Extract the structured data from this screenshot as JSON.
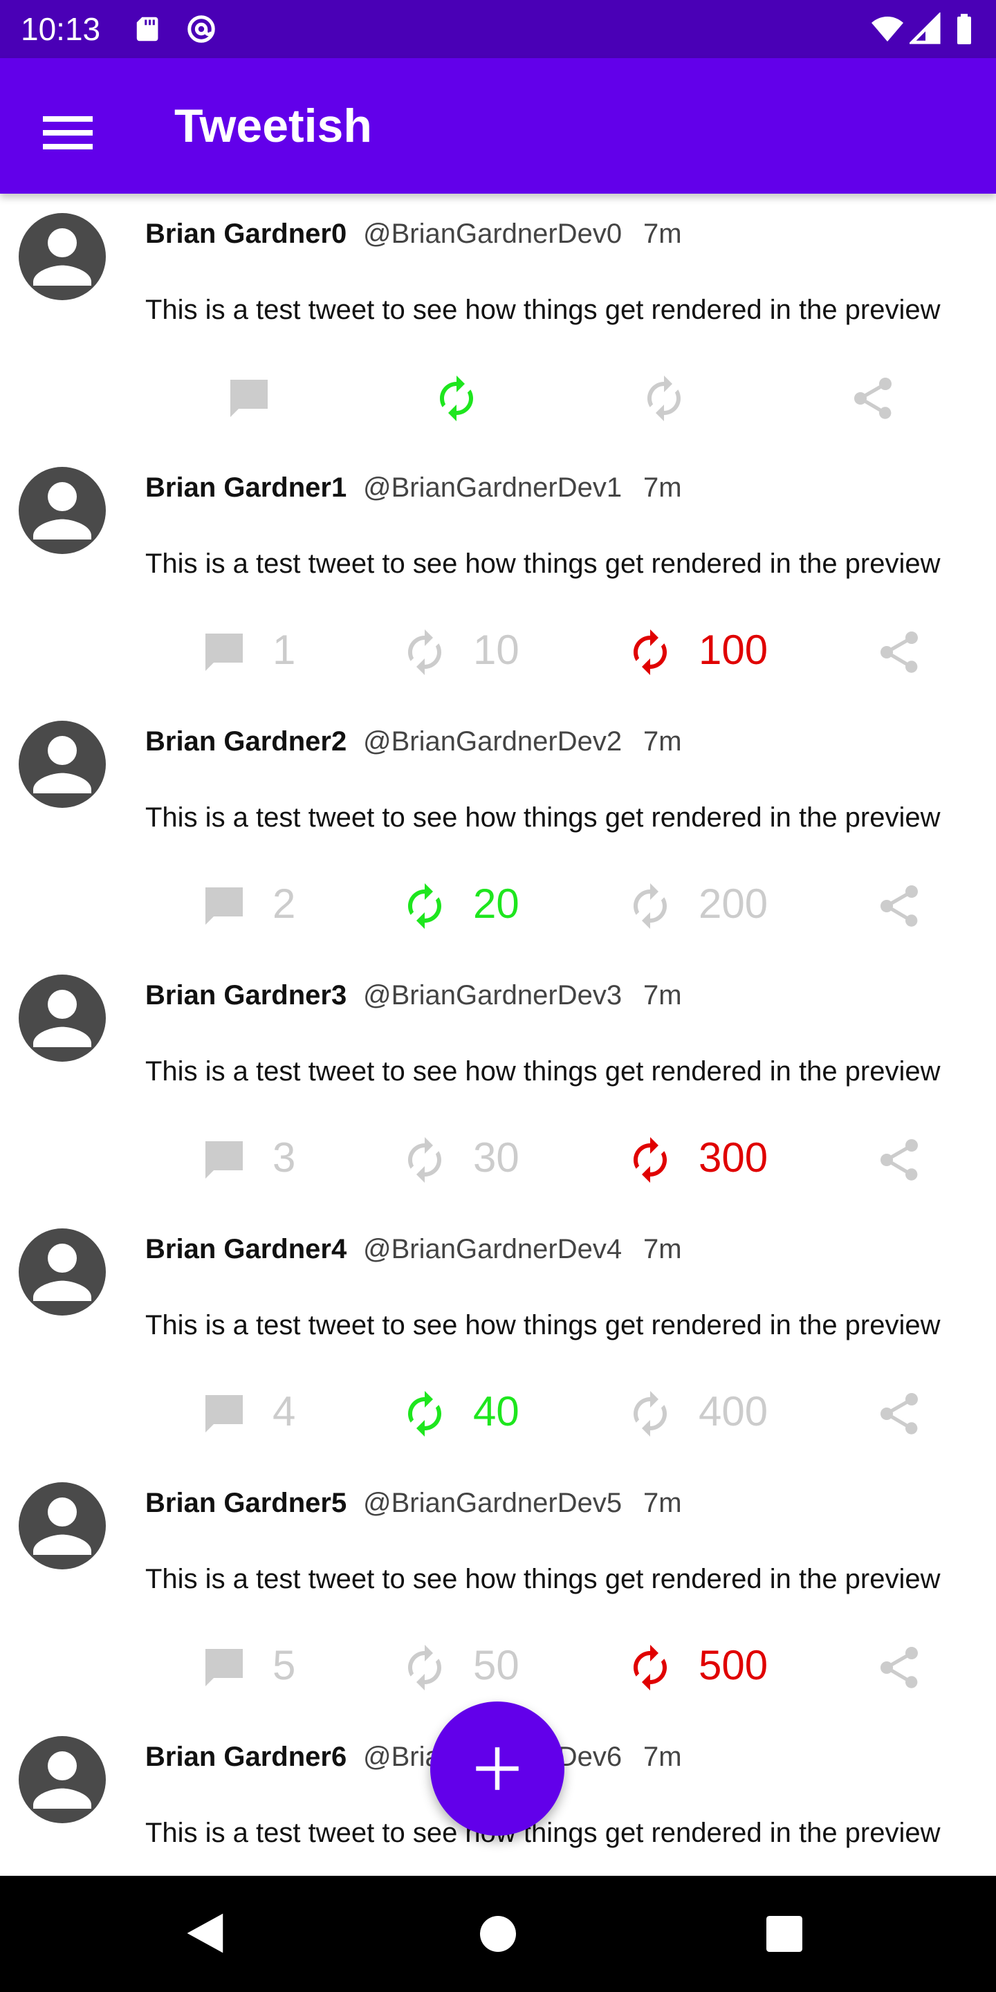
{
  "status_bar": {
    "time": "10:13",
    "left_icons": [
      "sd-card-icon",
      "at-sign-icon"
    ],
    "right_icons": [
      "wifi-icon",
      "signal-icon",
      "battery-icon"
    ]
  },
  "app_bar": {
    "title": "Tweetish",
    "menu_icon": "menu-icon"
  },
  "colors": {
    "status_bar": "#4a00b6",
    "app_bar": "#6200ea",
    "fab": "#6200ea",
    "active_green": "#1ee61e",
    "active_red": "#e00000",
    "inactive_gray": "#cccccc",
    "avatar_bg": "#4a4a4a"
  },
  "tweets": [
    {
      "name": "Brian Gardner0",
      "handle": "@BrianGardnerDev0",
      "time": "7m",
      "text": "This is a test tweet to see how things get rendered in the preview",
      "actions": [
        {
          "icon": "comment",
          "state": "inactive",
          "count": ""
        },
        {
          "icon": "retweet",
          "state": "green",
          "count": ""
        },
        {
          "icon": "retweet",
          "state": "inactive",
          "count": ""
        },
        {
          "icon": "share",
          "state": "inactive",
          "count": ""
        }
      ]
    },
    {
      "name": "Brian Gardner1",
      "handle": "@BrianGardnerDev1",
      "time": "7m",
      "text": "This is a test tweet to see how things get rendered in the preview",
      "actions": [
        {
          "icon": "comment",
          "state": "inactive",
          "count": "1"
        },
        {
          "icon": "retweet",
          "state": "inactive",
          "count": "10"
        },
        {
          "icon": "retweet",
          "state": "red",
          "count": "100"
        },
        {
          "icon": "share",
          "state": "inactive",
          "count": ""
        }
      ]
    },
    {
      "name": "Brian Gardner2",
      "handle": "@BrianGardnerDev2",
      "time": "7m",
      "text": "This is a test tweet to see how things get rendered in the preview",
      "actions": [
        {
          "icon": "comment",
          "state": "inactive",
          "count": "2"
        },
        {
          "icon": "retweet",
          "state": "green",
          "count": "20"
        },
        {
          "icon": "retweet",
          "state": "inactive",
          "count": "200"
        },
        {
          "icon": "share",
          "state": "inactive",
          "count": ""
        }
      ]
    },
    {
      "name": "Brian Gardner3",
      "handle": "@BrianGardnerDev3",
      "time": "7m",
      "text": "This is a test tweet to see how things get rendered in the preview",
      "actions": [
        {
          "icon": "comment",
          "state": "inactive",
          "count": "3"
        },
        {
          "icon": "retweet",
          "state": "inactive",
          "count": "30"
        },
        {
          "icon": "retweet",
          "state": "red",
          "count": "300"
        },
        {
          "icon": "share",
          "state": "inactive",
          "count": ""
        }
      ]
    },
    {
      "name": "Brian Gardner4",
      "handle": "@BrianGardnerDev4",
      "time": "7m",
      "text": "This is a test tweet to see how things get rendered in the preview",
      "actions": [
        {
          "icon": "comment",
          "state": "inactive",
          "count": "4"
        },
        {
          "icon": "retweet",
          "state": "green",
          "count": "40"
        },
        {
          "icon": "retweet",
          "state": "inactive",
          "count": "400"
        },
        {
          "icon": "share",
          "state": "inactive",
          "count": ""
        }
      ]
    },
    {
      "name": "Brian Gardner5",
      "handle": "@BrianGardnerDev5",
      "time": "7m",
      "text": "This is a test tweet to see how things get rendered in the preview",
      "actions": [
        {
          "icon": "comment",
          "state": "inactive",
          "count": "5"
        },
        {
          "icon": "retweet",
          "state": "inactive",
          "count": "50"
        },
        {
          "icon": "retweet",
          "state": "red",
          "count": "500"
        },
        {
          "icon": "share",
          "state": "inactive",
          "count": ""
        }
      ]
    },
    {
      "name": "Brian Gardner6",
      "handle": "@BrianGardnerDev6",
      "time": "7m",
      "text": "This is a test tweet to see how things get rendered in the preview",
      "actions": []
    }
  ],
  "fab": {
    "icon": "add-icon"
  },
  "nav_bar": {
    "buttons": [
      "back-icon",
      "home-icon",
      "recents-icon"
    ]
  }
}
